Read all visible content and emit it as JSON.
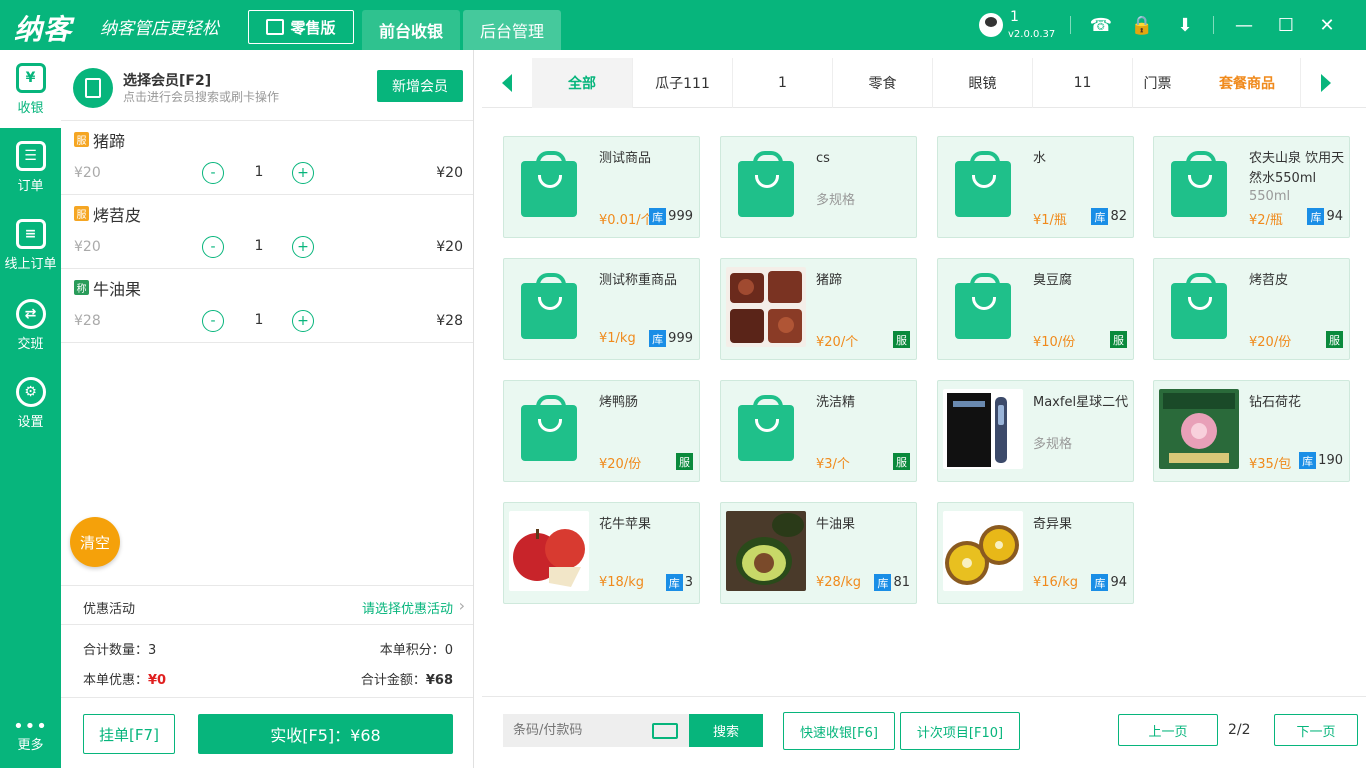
{
  "header": {
    "logo": "纳客",
    "slogan": "纳客管店更轻松",
    "edition": "零售版",
    "tabs": [
      {
        "label": "前台收银"
      },
      {
        "label": "后台管理"
      }
    ],
    "user_id": "1",
    "version": "v2.0.0.37"
  },
  "nav": {
    "items": [
      {
        "label": "收银",
        "icon": "cashier-icon"
      },
      {
        "label": "订单",
        "icon": "order-icon"
      },
      {
        "label": "线上订单",
        "icon": "online-order-icon"
      },
      {
        "label": "交班",
        "icon": "shift-icon"
      },
      {
        "label": "设置",
        "icon": "gear-icon"
      }
    ],
    "more": "更多"
  },
  "member": {
    "title": "选择会员[F2]",
    "subtitle": "点击进行会员搜索或刷卡操作",
    "add_button": "新增会员"
  },
  "cart": {
    "items": [
      {
        "badge": "服",
        "name": "猪蹄",
        "price": "¥20",
        "minus": "-",
        "qty": "1",
        "plus": "+",
        "total": "¥20"
      },
      {
        "badge": "服",
        "name": "烤苕皮",
        "price": "¥20",
        "minus": "-",
        "qty": "1",
        "plus": "+",
        "total": "¥20"
      },
      {
        "badge": "称",
        "name": "牛油果",
        "price": "¥28",
        "minus": "-",
        "qty": "1",
        "plus": "+",
        "total": "¥28"
      }
    ],
    "clear_button": "清空",
    "promo_label": "优惠活动",
    "promo_select": "请选择优惠活动",
    "total_qty_label": "合计数量：",
    "total_qty": "3",
    "points_label": "本单积分：",
    "points": "0",
    "discount_label": "本单优惠：",
    "discount": "¥0",
    "amount_label": "合计金额：",
    "amount": "¥68",
    "hold_button": "挂单[F7]",
    "pay_button": "实收[F5]：¥68"
  },
  "categories": {
    "tabs": [
      {
        "label": "全部"
      },
      {
        "label": "瓜子111"
      },
      {
        "label": "1"
      },
      {
        "label": "零食"
      },
      {
        "label": "眼镜"
      },
      {
        "label": "11"
      },
      {
        "label": "门票"
      }
    ],
    "package_tab": "套餐商品"
  },
  "products": [
    {
      "name": "测试商品",
      "spec": "",
      "price": "¥0.01/个",
      "badge": "库",
      "stock": "999"
    },
    {
      "name": "cs",
      "spec": "多规格",
      "price": "",
      "badge": "",
      "stock": ""
    },
    {
      "name": "水",
      "spec": "",
      "price": "¥1/瓶",
      "badge": "库",
      "stock": "82"
    },
    {
      "name": "农夫山泉 饮用天然水550ml",
      "spec": "550ml",
      "price": "¥2/瓶",
      "badge": "库",
      "stock": "94"
    },
    {
      "name": "测试称重商品",
      "spec": "",
      "price": "¥1/kg",
      "badge": "库",
      "stock": "999"
    },
    {
      "name": "猪蹄",
      "spec": "",
      "price": "¥20/个",
      "badge": "服",
      "stock": ""
    },
    {
      "name": "臭豆腐",
      "spec": "",
      "price": "¥10/份",
      "badge": "服",
      "stock": ""
    },
    {
      "name": "烤苕皮",
      "spec": "",
      "price": "¥20/份",
      "badge": "服",
      "stock": ""
    },
    {
      "name": "烤鸭肠",
      "spec": "",
      "price": "¥20/份",
      "badge": "服",
      "stock": ""
    },
    {
      "name": "洗洁精",
      "spec": "",
      "price": "¥3/个",
      "badge": "服",
      "stock": ""
    },
    {
      "name": "Maxfel星球二代",
      "spec": "多规格",
      "price": "",
      "badge": "",
      "stock": ""
    },
    {
      "name": "钻石荷花",
      "spec": "",
      "price": "¥35/包",
      "badge": "库",
      "stock": "190"
    },
    {
      "name": "花牛苹果",
      "spec": "",
      "price": "¥18/kg",
      "badge": "库",
      "stock": "3"
    },
    {
      "name": "牛油果",
      "spec": "",
      "price": "¥28/kg",
      "badge": "库",
      "stock": "81"
    },
    {
      "name": "奇异果",
      "spec": "",
      "price": "¥16/kg",
      "badge": "库",
      "stock": "94"
    }
  ],
  "bottom": {
    "search_placeholder": "条码/付款码",
    "search_button": "搜索",
    "quick_cash": "快速收银[F6]",
    "count_item": "计次项目[F10]",
    "prev": "上一页",
    "page": "2/2",
    "next": "下一页"
  },
  "colors": {
    "primary": "#07b57c",
    "price": "#f08a1c",
    "stock_badge": "#1a8ee6",
    "service_badge": "#0a8a3c",
    "clear": "#f5a10a"
  }
}
